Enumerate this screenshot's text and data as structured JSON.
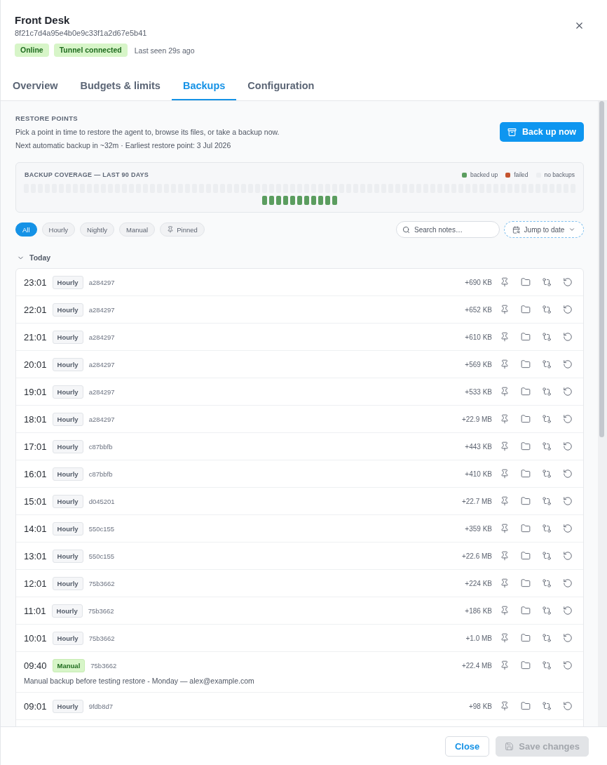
{
  "header": {
    "title": "Front Desk",
    "agent_id": "8f21c7d4a95e4b0e9c33f1a2d67e5b41",
    "badges": [
      "Online",
      "Tunnel connected"
    ],
    "last_seen": "Last seen 29s ago"
  },
  "tabs": [
    {
      "label": "Overview",
      "selected": false
    },
    {
      "label": "Budgets & limits",
      "selected": false
    },
    {
      "label": "Backups",
      "selected": true
    },
    {
      "label": "Configuration",
      "selected": false
    }
  ],
  "restore_points": {
    "heading": "RESTORE POINTS",
    "description": "Pick a point in time to restore the agent to, browse its files, or take a backup now.",
    "schedule": "Next automatic backup in ~32m · Earliest restore point: 3 Jul 2026",
    "action": "Back up now"
  },
  "coverage": {
    "title": "BACKUP COVERAGE — LAST 90 DAYS",
    "legend": [
      {
        "kind": "ok",
        "label": "backed up",
        "color": "#5b9d5f"
      },
      {
        "kind": "failed",
        "label": "failed",
        "color": "#c4542f"
      },
      {
        "kind": "none",
        "label": "no backups",
        "color": "#eceef1"
      }
    ],
    "days": [
      {
        "kind": "none"
      },
      {
        "kind": "none"
      },
      {
        "kind": "none"
      },
      {
        "kind": "none"
      },
      {
        "kind": "none"
      },
      {
        "kind": "none"
      },
      {
        "kind": "none"
      },
      {
        "kind": "none"
      },
      {
        "kind": "none"
      },
      {
        "kind": "none"
      },
      {
        "kind": "none"
      },
      {
        "kind": "none"
      },
      {
        "kind": "none"
      },
      {
        "kind": "none"
      },
      {
        "kind": "none"
      },
      {
        "kind": "none"
      },
      {
        "kind": "none"
      },
      {
        "kind": "none"
      },
      {
        "kind": "none"
      },
      {
        "kind": "none"
      },
      {
        "kind": "none"
      },
      {
        "kind": "none"
      },
      {
        "kind": "none"
      },
      {
        "kind": "none"
      },
      {
        "kind": "none"
      },
      {
        "kind": "none"
      },
      {
        "kind": "none"
      },
      {
        "kind": "none"
      },
      {
        "kind": "none"
      },
      {
        "kind": "none"
      },
      {
        "kind": "none"
      },
      {
        "kind": "none"
      },
      {
        "kind": "none"
      },
      {
        "kind": "none"
      },
      {
        "kind": "none"
      },
      {
        "kind": "none"
      },
      {
        "kind": "none"
      },
      {
        "kind": "none"
      },
      {
        "kind": "none"
      },
      {
        "kind": "none"
      },
      {
        "kind": "none"
      },
      {
        "kind": "none"
      },
      {
        "kind": "none"
      },
      {
        "kind": "none"
      },
      {
        "kind": "none"
      },
      {
        "kind": "none"
      },
      {
        "kind": "none"
      },
      {
        "kind": "none"
      },
      {
        "kind": "none"
      },
      {
        "kind": "none"
      },
      {
        "kind": "none"
      },
      {
        "kind": "none"
      },
      {
        "kind": "none"
      },
      {
        "kind": "none"
      },
      {
        "kind": "none"
      },
      {
        "kind": "none"
      },
      {
        "kind": "none"
      },
      {
        "kind": "none"
      },
      {
        "kind": "none"
      },
      {
        "kind": "none"
      },
      {
        "kind": "none"
      },
      {
        "kind": "none"
      },
      {
        "kind": "none"
      },
      {
        "kind": "none"
      },
      {
        "kind": "none"
      },
      {
        "kind": "none"
      },
      {
        "kind": "none"
      },
      {
        "kind": "none"
      },
      {
        "kind": "none"
      },
      {
        "kind": "none"
      },
      {
        "kind": "none"
      },
      {
        "kind": "none"
      },
      {
        "kind": "none"
      },
      {
        "kind": "none"
      },
      {
        "kind": "none"
      },
      {
        "kind": "none"
      },
      {
        "kind": "none"
      },
      {
        "kind": "none"
      },
      {
        "kind": "none"
      },
      {
        "kind": "ok"
      },
      {
        "kind": "ok"
      },
      {
        "kind": "ok"
      },
      {
        "kind": "ok"
      },
      {
        "kind": "ok"
      },
      {
        "kind": "ok"
      },
      {
        "kind": "ok"
      },
      {
        "kind": "ok"
      },
      {
        "kind": "ok"
      },
      {
        "kind": "ok"
      },
      {
        "kind": "ok"
      }
    ]
  },
  "filters": [
    {
      "label": "All",
      "selected": true,
      "kind": "plain"
    },
    {
      "label": "Hourly",
      "selected": false,
      "kind": "plain"
    },
    {
      "label": "Nightly",
      "selected": false,
      "kind": "plain"
    },
    {
      "label": "Manual",
      "selected": false,
      "kind": "plain"
    },
    {
      "label": "Pinned",
      "selected": false,
      "kind": "pinned"
    }
  ],
  "search": {
    "placeholder": "Search notes…"
  },
  "jump_to_date": {
    "label": "Jump to date"
  },
  "groups": [
    {
      "label": "Today",
      "expanded": true,
      "rows": [
        {
          "time": "23:01",
          "kind": "hourly",
          "tag": "Hourly",
          "commit": "a284297",
          "size": "+690 KB"
        },
        {
          "time": "22:01",
          "kind": "hourly",
          "tag": "Hourly",
          "commit": "a284297",
          "size": "+652 KB"
        },
        {
          "time": "21:01",
          "kind": "hourly",
          "tag": "Hourly",
          "commit": "a284297",
          "size": "+610 KB"
        },
        {
          "time": "20:01",
          "kind": "hourly",
          "tag": "Hourly",
          "commit": "a284297",
          "size": "+569 KB"
        },
        {
          "time": "19:01",
          "kind": "hourly",
          "tag": "Hourly",
          "commit": "a284297",
          "size": "+533 KB"
        },
        {
          "time": "18:01",
          "kind": "hourly",
          "tag": "Hourly",
          "commit": "a284297",
          "size": "+22.9 MB"
        },
        {
          "time": "17:01",
          "kind": "hourly",
          "tag": "Hourly",
          "commit": "c87bbfb",
          "size": "+443 KB"
        },
        {
          "time": "16:01",
          "kind": "hourly",
          "tag": "Hourly",
          "commit": "c87bbfb",
          "size": "+410 KB"
        },
        {
          "time": "15:01",
          "kind": "hourly",
          "tag": "Hourly",
          "commit": "d045201",
          "size": "+22.7 MB"
        },
        {
          "time": "14:01",
          "kind": "hourly",
          "tag": "Hourly",
          "commit": "550c155",
          "size": "+359 KB"
        },
        {
          "time": "13:01",
          "kind": "hourly",
          "tag": "Hourly",
          "commit": "550c155",
          "size": "+22.6 MB"
        },
        {
          "time": "12:01",
          "kind": "hourly",
          "tag": "Hourly",
          "commit": "75b3662",
          "size": "+224 KB"
        },
        {
          "time": "11:01",
          "kind": "hourly",
          "tag": "Hourly",
          "commit": "75b3662",
          "size": "+186 KB"
        },
        {
          "time": "10:01",
          "kind": "hourly",
          "tag": "Hourly",
          "commit": "75b3662",
          "size": "+1.0 MB"
        },
        {
          "time": "09:40",
          "kind": "manual",
          "tag": "Manual",
          "commit": "75b3662",
          "size": "+22.4 MB",
          "note": "Manual backup before testing restore - Monday — alex@example.com"
        },
        {
          "time": "09:01",
          "kind": "hourly",
          "tag": "Hourly",
          "commit": "9fdb8d7",
          "size": "+98 KB"
        }
      ]
    }
  ],
  "footer": {
    "buttons": [
      {
        "label": "Close",
        "kind": "secondary",
        "disabled": false
      },
      {
        "label": "Save changes",
        "kind": "primary",
        "disabled": true
      }
    ]
  }
}
